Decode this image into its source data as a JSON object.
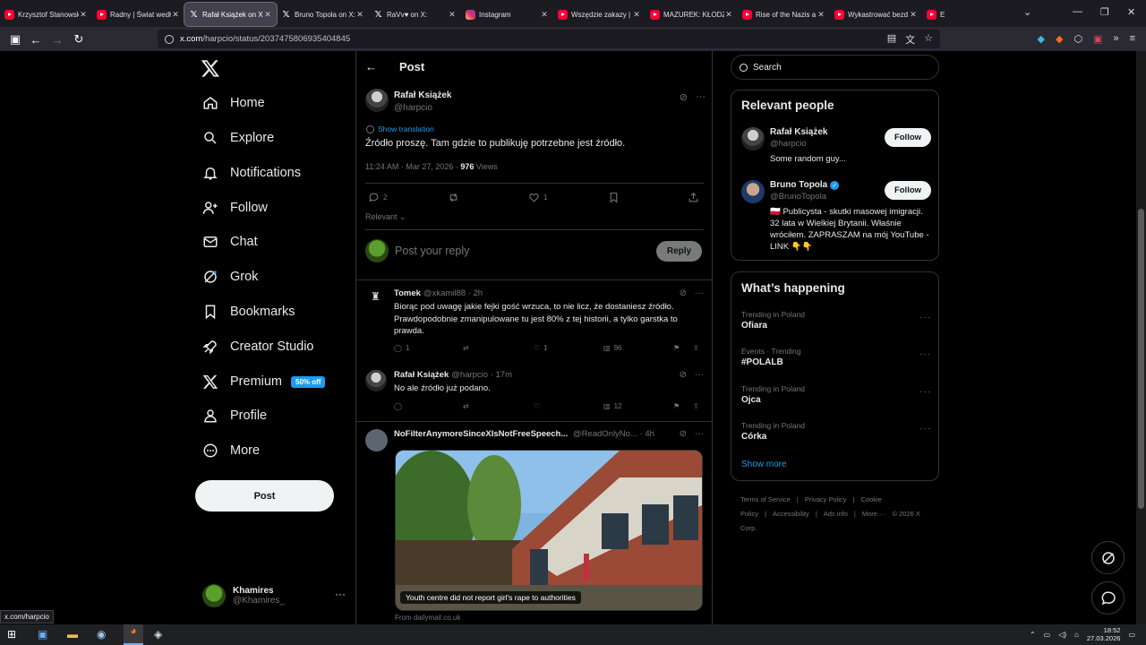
{
  "browser": {
    "tabs": [
      {
        "title": "Krzysztof Stanowski",
        "icon": "youtube-icon",
        "active": false
      },
      {
        "title": "Radny | Świat według",
        "icon": "youtube-icon",
        "active": false
      },
      {
        "title": "Rafał Książek on X:",
        "icon": "x-icon",
        "active": true
      },
      {
        "title": "Bruno Topola on X:",
        "icon": "x-icon",
        "active": false
      },
      {
        "title": "RaVv♥ on X:",
        "icon": "x-icon",
        "active": false
      },
      {
        "title": "Instagram",
        "icon": "instagram-icon",
        "active": false
      },
      {
        "title": "Wszędzie zakazy | K",
        "icon": "youtube-icon",
        "active": false
      },
      {
        "title": "MAZUREK: KŁODZK",
        "icon": "youtube-icon",
        "active": false
      },
      {
        "title": "Rise of the Nazis a",
        "icon": "youtube-icon",
        "active": false
      },
      {
        "title": "Wykastrować bezd",
        "icon": "youtube-icon",
        "active": false
      },
      {
        "title": "E",
        "icon": "youtube-icon",
        "active": false
      }
    ],
    "url_domain": "x.com",
    "url_path": "/harpcio/status/2037475806935404845",
    "status_url": "x.com/harpcio"
  },
  "nav": {
    "items": [
      {
        "label": "Home",
        "icon": "home-icon"
      },
      {
        "label": "Explore",
        "icon": "search-icon"
      },
      {
        "label": "Notifications",
        "icon": "bell-icon"
      },
      {
        "label": "Follow",
        "icon": "person-add-icon"
      },
      {
        "label": "Chat",
        "icon": "mail-icon"
      },
      {
        "label": "Grok",
        "icon": "grok-icon"
      },
      {
        "label": "Bookmarks",
        "icon": "bookmark-icon"
      },
      {
        "label": "Creator Studio",
        "icon": "rocket-icon"
      },
      {
        "label": "Premium",
        "icon": "x-icon"
      },
      {
        "label": "Profile",
        "icon": "person-icon"
      },
      {
        "label": "More",
        "icon": "more-circle-icon"
      }
    ],
    "premium_badge": "50% off",
    "post_label": "Post",
    "account": {
      "name": "Khamires",
      "handle": "@Khamires_"
    }
  },
  "post": {
    "header_title": "Post",
    "author_name": "Rafał Książek",
    "author_handle": "@harpcio",
    "show_translation": "Show translation",
    "text": "Źródło proszę. Tam gdzie to publikuję potrzebne jest źródło.",
    "time": "11:24 AM · Mar 27, 2026 · ",
    "views_count": "976",
    "views_label": " Views",
    "replies": "2",
    "likes": "1",
    "sort_label": "Relevant",
    "reply_placeholder": "Post your reply",
    "reply_button": "Reply"
  },
  "comments": [
    {
      "name": "Tomek",
      "handle": "@xkamil88 · 2h",
      "text": "Biorąc pod uwagę jakie fejki gość wrzuca, to nie licz, że dostaniesz źródło. Prawdopodobnie zmanipulowane tu jest 80% z tej historii, a tylko garstka to prawda.",
      "replies": "1",
      "likes": "1",
      "views": "96"
    },
    {
      "name": "Rafał Książek",
      "handle": "@harpcio · 17m",
      "text": "No ale źródło już podano.",
      "replies": "",
      "likes": "",
      "views": "12"
    },
    {
      "name": "NoFilterAnymoreSinceXIsNotFreeSpeech...",
      "handle": "@ReadOnlyNo... · 4h",
      "image_caption": "Youth centre did not report girl's rape to authorities",
      "source": "From dailymail.co.uk"
    }
  ],
  "sidebar": {
    "search_placeholder": "Search",
    "relevant_title": "Relevant people",
    "people": [
      {
        "name": "Rafał Książek",
        "handle": "@harpcio",
        "bio": "Some random guy...",
        "follow": "Follow",
        "verified": false
      },
      {
        "name": "Bruno Topola",
        "handle": "@BrunoTopola",
        "bio": "🇵🇱 Publicysta - skutki masowej imigracji. 32 lata w Wielkiej Brytanii. Właśnie wróciłem. ZAPRASZAM na mój YouTube - LINK 👇👇",
        "follow": "Follow",
        "verified": true
      }
    ],
    "happening_title": "What’s happening",
    "trends": [
      {
        "category": "Trending in Poland",
        "title": "Ofiara"
      },
      {
        "category": "Events · Trending",
        "title": "#POLALB"
      },
      {
        "category": "Trending in Poland",
        "title": "Ojca"
      },
      {
        "category": "Trending in Poland",
        "title": "Córka"
      }
    ],
    "show_more": "Show more",
    "footer": [
      "Terms of Service",
      "|",
      "Privacy Policy",
      "|",
      "Cookie Policy",
      "|",
      "Accessibility",
      "|",
      "Ads info",
      "|",
      "More ···",
      "© 2026 X Corp."
    ]
  },
  "taskbar": {
    "time": "18:52",
    "date": "27.03.2026"
  },
  "colors": {
    "accent": "#1d9bf0",
    "muted": "#71767b",
    "text": "#e7e9ea",
    "border": "#2f3336"
  }
}
